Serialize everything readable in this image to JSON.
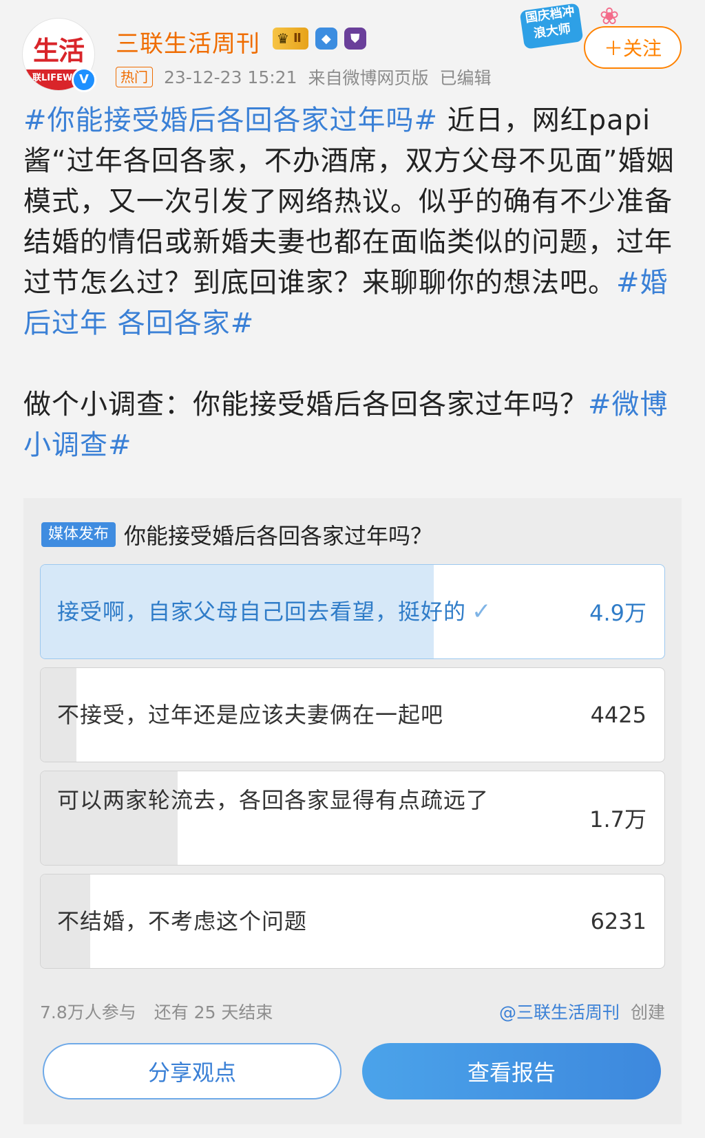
{
  "post": {
    "author": "三联生活周刊",
    "avatar_text": "生活",
    "avatar_band": "联LIFEW",
    "verified_mark": "V",
    "level_badge": "Ⅱ",
    "hot_tag": "热门",
    "time": "23-12-23 15:21",
    "source": "来自微博网页版",
    "edited": "已编辑",
    "promo_text": "国庆档冲浪大师",
    "follow_label": "＋关注",
    "hashtag1": "#你能接受婚后各回各家过年吗#",
    "body1": " 近日，网红papi酱“过年各回各家，不办酒席，双方父母不见面”婚姻模式，又一次引发了网络热议。似乎的确有不少准备结婚的情侣或新婚夫妻也都在面临类似的问题，过年过节怎么过？到底回谁家？来聊聊你的想法吧。",
    "hashtag2": "#婚后过年 各回各家#",
    "body2": "做个小调查：你能接受婚后各回各家过年吗？",
    "hashtag3": "#微博小调查#"
  },
  "poll": {
    "media_tag": "媒体发布",
    "question": "你能接受婚后各回各家过年吗？",
    "options": [
      {
        "label": "接受啊，自家父母自己回去看望，挺好的",
        "count": "4.9万",
        "share": 0.63,
        "voted": true,
        "check": "✓"
      },
      {
        "label": "不接受，过年还是应该夫妻俩在一起吧",
        "count": "4425",
        "share": 0.057,
        "voted": false
      },
      {
        "label": "可以两家轮流去，各回各家显得有点疏远了",
        "count": "1.7万",
        "share": 0.22,
        "voted": false
      },
      {
        "label": "不结婚，不考虑这个问题",
        "count": "6231",
        "share": 0.08,
        "voted": false
      }
    ],
    "participants": "7.8万人参与",
    "remaining": "还有 25 天结束",
    "creator": "@三联生活周刊",
    "created": "创建",
    "share_button": "分享观点",
    "report_button": "查看报告"
  },
  "colors": {
    "accent_blue": "#3a80d6",
    "follow_orange": "#ff8200",
    "username_orange": "#ef6c00"
  }
}
